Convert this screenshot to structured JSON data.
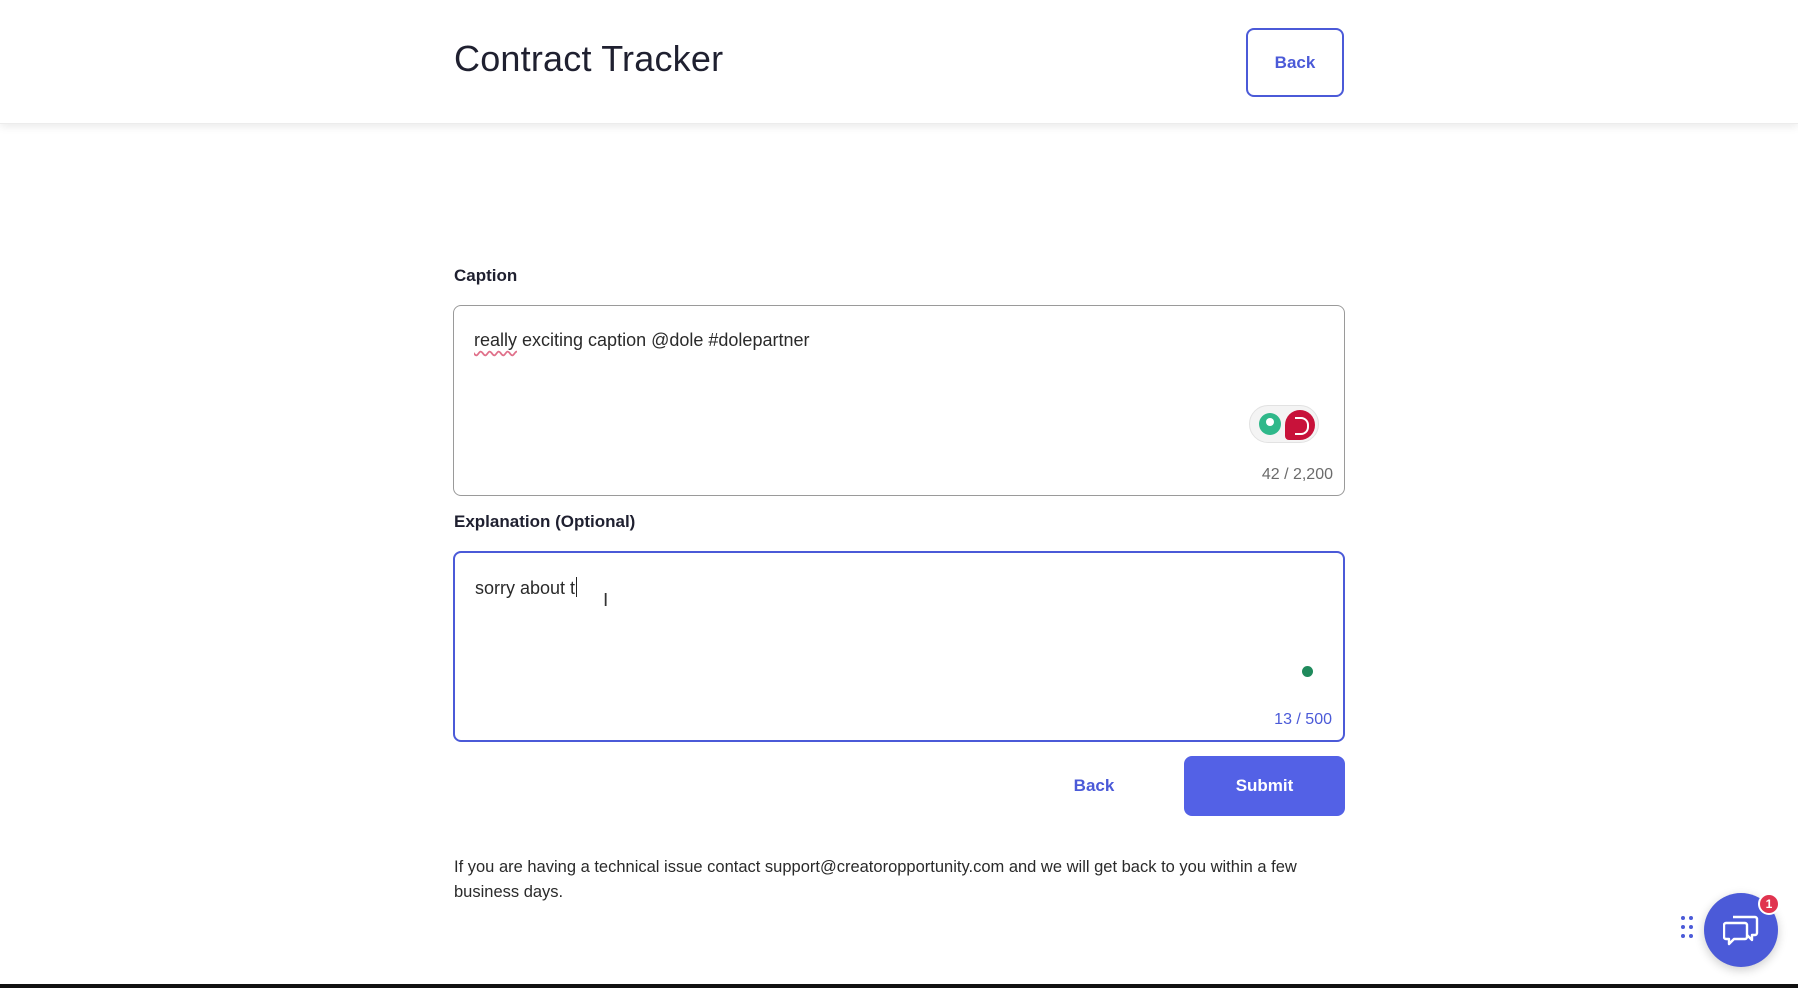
{
  "header": {
    "title": "Contract Tracker",
    "back_label": "Back"
  },
  "caption": {
    "label": "Caption",
    "value_word1": "really",
    "value_rest": " exciting caption @dole #dolepartner",
    "count": "42 / 2,200"
  },
  "explanation": {
    "label": "Explanation (Optional)",
    "value": "sorry about t",
    "count": "13 / 500"
  },
  "actions": {
    "back_label": "Back",
    "submit_label": "Submit"
  },
  "footer": {
    "note": "If you are having a technical issue contact support@creatoropportunity.com and we will get back to you within a few business days."
  },
  "chat": {
    "badge_count": "1"
  },
  "colors": {
    "accent": "#4b5ad8",
    "submit_bg": "#5361e6",
    "badge": "#e0344f",
    "status_dot": "#1f8a5c"
  },
  "icons": [
    "lightbulb-icon",
    "grammar-assistant-icon",
    "text-cursor-icon",
    "grid-handle-icon",
    "chat-icon"
  ]
}
